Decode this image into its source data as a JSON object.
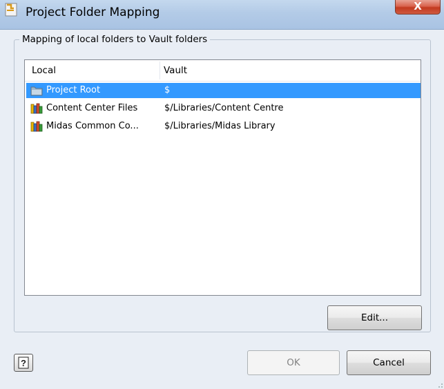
{
  "window": {
    "title": "Project Folder Mapping",
    "close_label": "X"
  },
  "group": {
    "label": "Mapping of local folders to Vault folders"
  },
  "list": {
    "columns": [
      "Local",
      "Vault"
    ],
    "rows": [
      {
        "local": "Project Root",
        "vault": "$",
        "icon": "folder-icon",
        "selected": true
      },
      {
        "local": "Content Center Files",
        "vault": "$/Libraries/Content Centre",
        "icon": "library-icon",
        "selected": false
      },
      {
        "local": "Midas Common Co...",
        "vault": "$/Libraries/Midas Library",
        "icon": "library-icon",
        "selected": false
      }
    ]
  },
  "buttons": {
    "edit": "Edit...",
    "ok": "OK",
    "cancel": "Cancel"
  },
  "colors": {
    "selection": "#3399ff",
    "titlebar": "#b3cbe7",
    "close": "#c23a1f"
  }
}
